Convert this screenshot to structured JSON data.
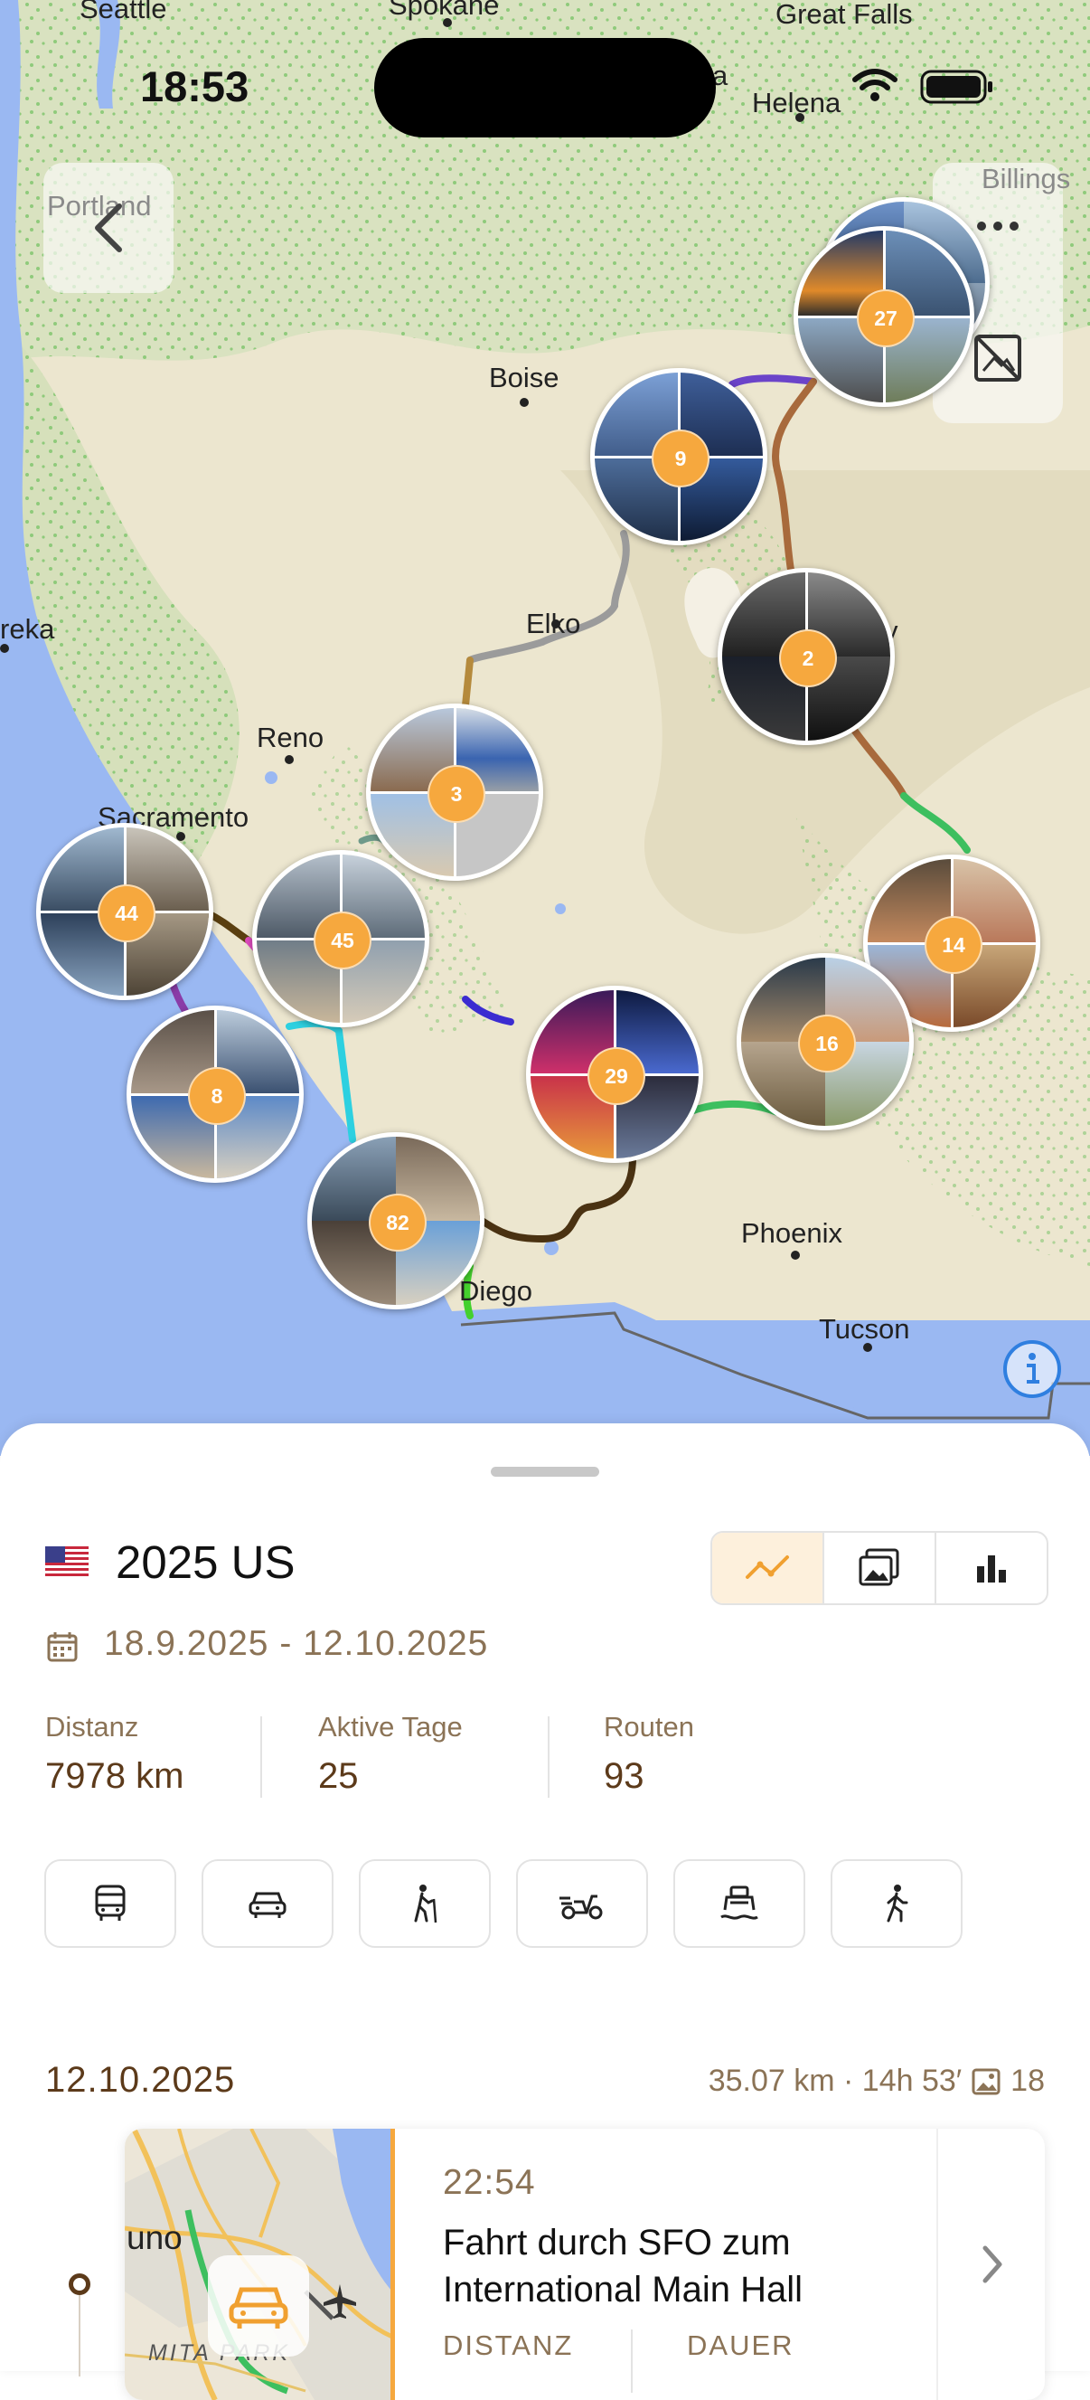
{
  "status": {
    "time": "18:53"
  },
  "map": {
    "labels": {
      "seattle": "Seattle",
      "spokane": "Spokane",
      "great_falls": "Great Falls",
      "helena": "Helena",
      "portland": "Portland",
      "billings": "Billings",
      "boise": "Boise",
      "elko": "Elko",
      "eureka": "reka",
      "reno": "Reno",
      "sacramento": "Sacramento",
      "phoenix": "Phoenix",
      "tucson": "Tucson",
      "san_diego": "Diego",
      "a": "a",
      "y": "y"
    },
    "clusters": [
      {
        "id": "c27",
        "count": "27"
      },
      {
        "id": "c9",
        "count": "9"
      },
      {
        "id": "c2",
        "count": "2"
      },
      {
        "id": "c3",
        "count": "3"
      },
      {
        "id": "c44",
        "count": "44"
      },
      {
        "id": "c45",
        "count": "45"
      },
      {
        "id": "c14",
        "count": "14"
      },
      {
        "id": "c16",
        "count": "16"
      },
      {
        "id": "c29",
        "count": "29"
      },
      {
        "id": "c8",
        "count": "8"
      },
      {
        "id": "c82",
        "count": "82"
      }
    ]
  },
  "trip": {
    "flag": "us-flag",
    "title": "2025 US",
    "date_range": "18.9.2025 - 12.10.2025",
    "stats": [
      {
        "label": "Distanz",
        "value": "7978 km"
      },
      {
        "label": "Aktive Tage",
        "value": "25"
      },
      {
        "label": "Routen",
        "value": "93"
      }
    ],
    "view_modes": [
      "route-icon",
      "photo-icon",
      "chart-icon"
    ],
    "transport_modes": [
      "bus-icon",
      "car-icon",
      "hiking-icon",
      "scooter-icon",
      "ferry-icon",
      "walking-icon"
    ]
  },
  "day": {
    "date": "12.10.2025",
    "meta": "35.07 km · 14h 53′",
    "photo_count": "18"
  },
  "entry": {
    "time": "22:54",
    "title": "Fahrt durch SFO zum International Main Hall",
    "label_distance": "DISTANZ",
    "label_duration": "DAUER",
    "map_label_1": "uno",
    "map_label_2": "MITA PARK"
  },
  "colors": {
    "accent": "#f6a83e",
    "brown_text": "#5c3a1a",
    "muted_text": "#8b7356",
    "water": "#9ab8f2",
    "land": "#e9e3cc"
  }
}
